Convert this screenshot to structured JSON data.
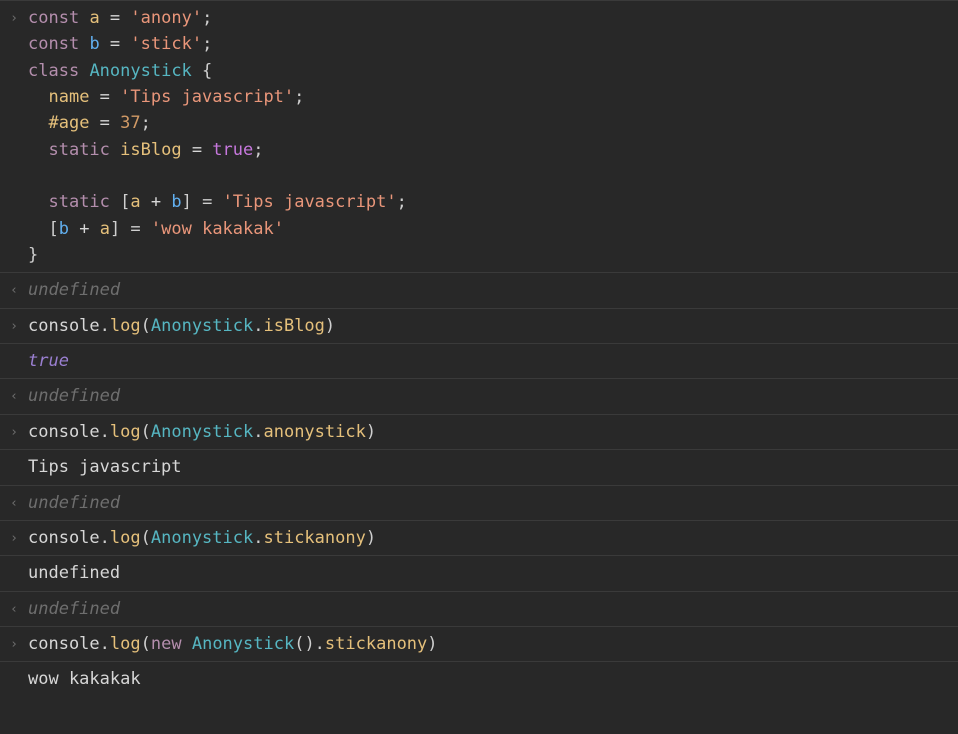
{
  "glyph": {
    "input": "›",
    "output": "‹"
  },
  "code": {
    "l1": {
      "kw": "const",
      "v": "a",
      "eq": " = ",
      "s": "'anony'",
      "end": ";"
    },
    "l2": {
      "kw": "const",
      "v": "b",
      "eq": " = ",
      "s": "'stick'",
      "end": ";"
    },
    "l3": {
      "kw": "class",
      "cls": "Anonystick",
      "brace": " {"
    },
    "l4": {
      "v": "name",
      "eq": " = ",
      "s": "'Tips javascript'",
      "end": ";"
    },
    "l5": {
      "v": "#age",
      "eq": " = ",
      "n": "37",
      "end": ";"
    },
    "l6": {
      "kw": "static",
      "v": "isBlog",
      "eq": " = ",
      "b": "true",
      "end": ";"
    },
    "l7_blank": "",
    "l8": {
      "kw": "static",
      "lb": " [",
      "a": "a",
      "plus": " + ",
      "b": "b",
      "rb": "] = ",
      "s": "'Tips javascript'",
      "end": ";"
    },
    "l9": {
      "lb": "[",
      "b": "b",
      "plus": " + ",
      "a": "a",
      "rb": "] = ",
      "s": "'wow kakakak'"
    },
    "l10": {
      "brace": "}"
    }
  },
  "r1": {
    "text": "undefined"
  },
  "r2": {
    "obj": "console",
    "dot1": ".",
    "fn": "log",
    "lp": "(",
    "cls": "Anonystick",
    "dot2": ".",
    "prop": "isBlog",
    "rp": ")"
  },
  "r2out": {
    "val": "true"
  },
  "r3": {
    "text": "undefined"
  },
  "r4": {
    "obj": "console",
    "dot1": ".",
    "fn": "log",
    "lp": "(",
    "cls": "Anonystick",
    "dot2": ".",
    "prop": "anonystick",
    "rp": ")"
  },
  "r4out": {
    "val": "Tips javascript"
  },
  "r5": {
    "text": "undefined"
  },
  "r6": {
    "obj": "console",
    "dot1": ".",
    "fn": "log",
    "lp": "(",
    "cls": "Anonystick",
    "dot2": ".",
    "prop": "stickanony",
    "rp": ")"
  },
  "r6out": {
    "val": "undefined"
  },
  "r7": {
    "text": "undefined"
  },
  "r8": {
    "obj": "console",
    "dot1": ".",
    "fn": "log",
    "lp": "(",
    "kw": "new",
    "sp": " ",
    "cls": "Anonystick",
    "call": "().",
    "prop": "stickanony",
    "rp": ")"
  },
  "r8out": {
    "val": "wow kakakak"
  }
}
